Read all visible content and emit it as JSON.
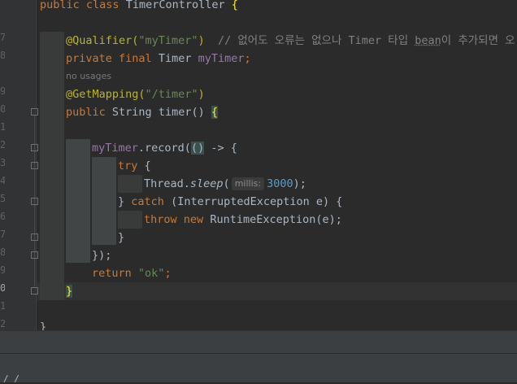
{
  "editor": {
    "gutter_numbers": [
      "",
      "",
      "7",
      "8",
      "",
      "9",
      "0",
      "1",
      "2",
      "3",
      "4",
      "5",
      "6",
      "7",
      "8",
      "9",
      "0",
      "1",
      "2"
    ],
    "no_usages_hint": "no usages",
    "param_hint": "millis:",
    "lines": {
      "l1": [
        "public",
        "class",
        "TimerController",
        "{"
      ],
      "l3": [
        "@Qualifier(",
        "\"myTimer\"",
        ")",
        "// 없어도 오류는 없으나 Timer 타입 ",
        "bean",
        "이 추가되면 오"
      ],
      "l4": [
        "private",
        "final",
        "Timer",
        "myTimer",
        ";"
      ],
      "l6": [
        "@GetMapping(",
        "\"/timer\"",
        ")"
      ],
      "l7": [
        "public",
        "String",
        "timer",
        "()",
        "{"
      ],
      "l9": [
        "myTimer",
        ".record(",
        "()",
        "->",
        "{"
      ],
      "l10": [
        "try",
        "{"
      ],
      "l11": [
        "Thread.",
        "sleep",
        "(",
        "3000",
        ");"
      ],
      "l12": [
        "}",
        "catch",
        "(InterruptedException e)",
        "{"
      ],
      "l13": [
        "throw",
        "new",
        "RuntimeException(e);"
      ],
      "l14": [
        "}"
      ],
      "l15": [
        "});"
      ],
      "l16": [
        "return",
        "\"ok\"",
        ";"
      ],
      "l17": [
        "}"
      ],
      "l19": [
        "}"
      ]
    }
  },
  "breadcrumb": "/ /"
}
